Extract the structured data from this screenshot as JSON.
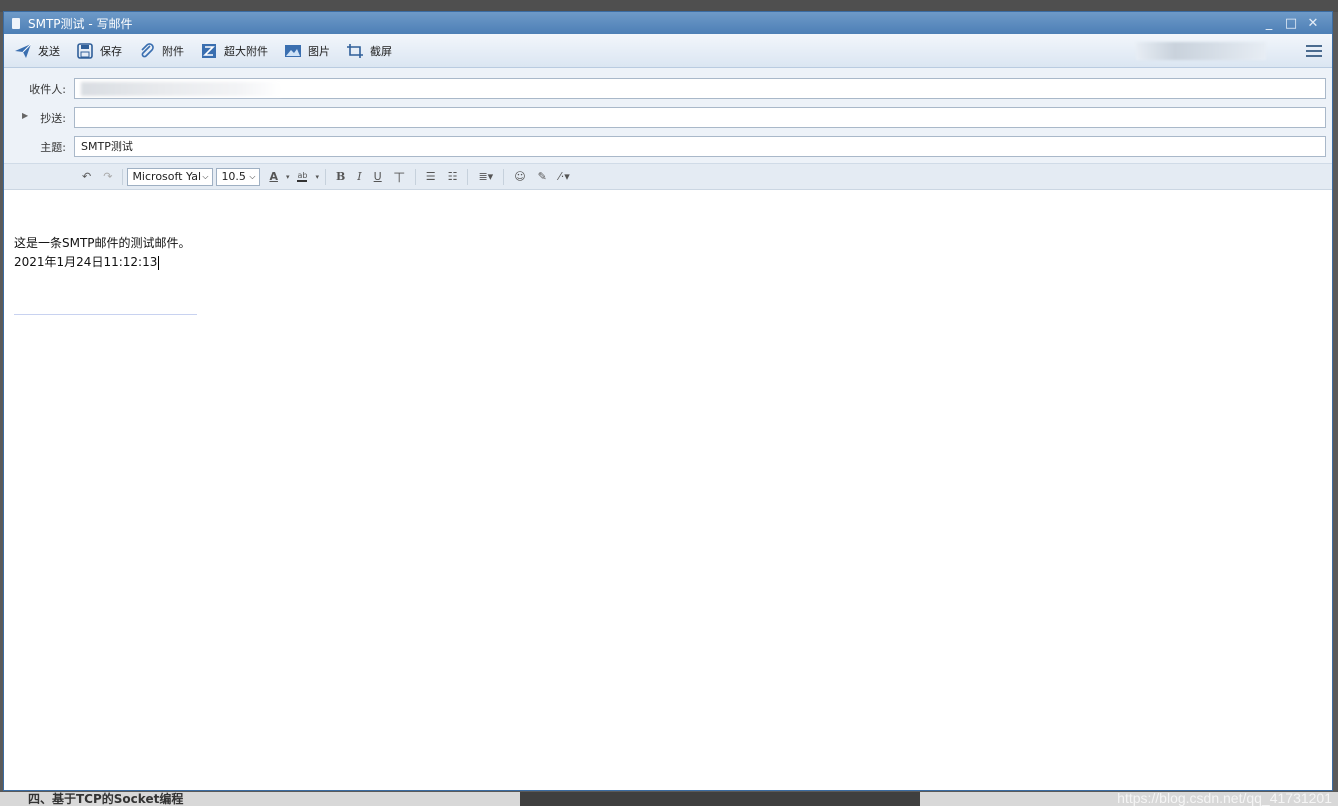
{
  "window": {
    "title": "SMTP测试 - 写邮件",
    "controls": [
      "_",
      "□",
      "✕"
    ]
  },
  "toolbar": {
    "buttons": [
      {
        "label": "发送",
        "icon": "send-icon"
      },
      {
        "label": "保存",
        "icon": "save-icon"
      },
      {
        "label": "附件",
        "icon": "paperclip-icon"
      },
      {
        "label": "超大附件",
        "icon": "large-attachment-icon"
      },
      {
        "label": "图片",
        "icon": "image-icon"
      },
      {
        "label": "截屏",
        "icon": "screenshot-icon"
      }
    ],
    "menu_icon": "menu-icon"
  },
  "fields": {
    "to_label": "收件人:",
    "cc_label": "抄送:",
    "subject_label": "主题:",
    "subject_value": "SMTP测试"
  },
  "format": {
    "font": "Microsoft Yal",
    "size": "10.5"
  },
  "body": {
    "line1": "这是一条SMTP邮件的测试邮件。",
    "line2": "2021年1月24日11:12:13"
  },
  "background": {
    "text": "四、基于TCP的Socket编程",
    "watermark": "https://blog.csdn.net/qq_41731201"
  }
}
